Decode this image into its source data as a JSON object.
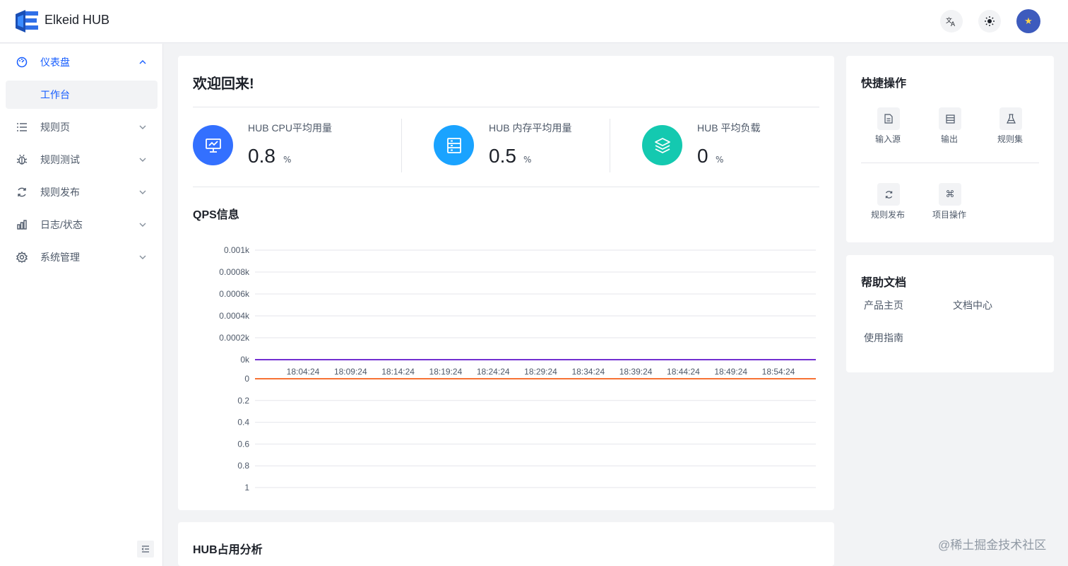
{
  "app": {
    "title": "Elkeid HUB"
  },
  "header": {
    "lang_icon": "translate-icon",
    "theme_icon": "sun-icon",
    "avatar_icon": "star-avatar"
  },
  "sidebar": {
    "items": [
      {
        "label": "仪表盘",
        "icon": "dashboard-icon",
        "expanded": true
      },
      {
        "label": "工作台",
        "sub": true
      },
      {
        "label": "规则页",
        "icon": "list-icon"
      },
      {
        "label": "规则测试",
        "icon": "bug-icon"
      },
      {
        "label": "规则发布",
        "icon": "sync-icon"
      },
      {
        "label": "日志/状态",
        "icon": "bar-chart-icon"
      },
      {
        "label": "系统管理",
        "icon": "settings-icon"
      }
    ],
    "collapse_icon": "menu-fold-icon"
  },
  "main": {
    "welcome": "欢迎回来!",
    "stats": [
      {
        "label": "HUB CPU平均用量",
        "value": "0.8",
        "unit": "%",
        "color": "#3370ff"
      },
      {
        "label": "HUB 内存平均用量",
        "value": "0.5",
        "unit": "%",
        "color": "#1aa3ff"
      },
      {
        "label": "HUB 平均负载",
        "value": "0",
        "unit": "%",
        "color": "#14c9b0"
      }
    ],
    "qps_title": "QPS信息",
    "hub_title": "HUB占用分析"
  },
  "chart_data": {
    "type": "line",
    "title": "QPS信息",
    "x": [
      "18:04:24",
      "18:09:24",
      "18:14:24",
      "18:19:24",
      "18:24:24",
      "18:29:24",
      "18:34:24",
      "18:39:24",
      "18:44:24",
      "18:49:24",
      "18:54:24"
    ],
    "upper_axis": {
      "ticks": [
        "0.001k",
        "0.0008k",
        "0.0006k",
        "0.0004k",
        "0.0002k",
        "0k"
      ],
      "ylim": [
        0,
        0.001
      ]
    },
    "lower_axis": {
      "ticks": [
        "0",
        "0.2",
        "0.4",
        "0.6",
        "0.8",
        "1"
      ],
      "ylim": [
        0,
        1
      ],
      "inverted": true
    },
    "series": [
      {
        "values": [
          0,
          0,
          0,
          0,
          0,
          0,
          0,
          0,
          0,
          0,
          0
        ],
        "color": "#722ed1",
        "axis": "upper"
      },
      {
        "values": [
          0,
          0,
          0,
          0,
          0,
          0,
          0,
          0,
          0,
          0,
          0
        ],
        "color": "#f77234",
        "axis": "lower"
      }
    ],
    "grid": true
  },
  "quick": {
    "title": "快捷操作",
    "items": [
      {
        "label": "输入源",
        "icon": "file-icon"
      },
      {
        "label": "输出",
        "icon": "storage-icon"
      },
      {
        "label": "规则集",
        "icon": "experiment-icon"
      },
      {
        "label": "规则发布",
        "icon": "sync-icon"
      },
      {
        "label": "项目操作",
        "icon": "command-icon"
      }
    ]
  },
  "help": {
    "title": "帮助文档",
    "links": [
      "产品主页",
      "文档中心",
      "使用指南"
    ]
  },
  "watermark": "@稀土掘金技术社区"
}
